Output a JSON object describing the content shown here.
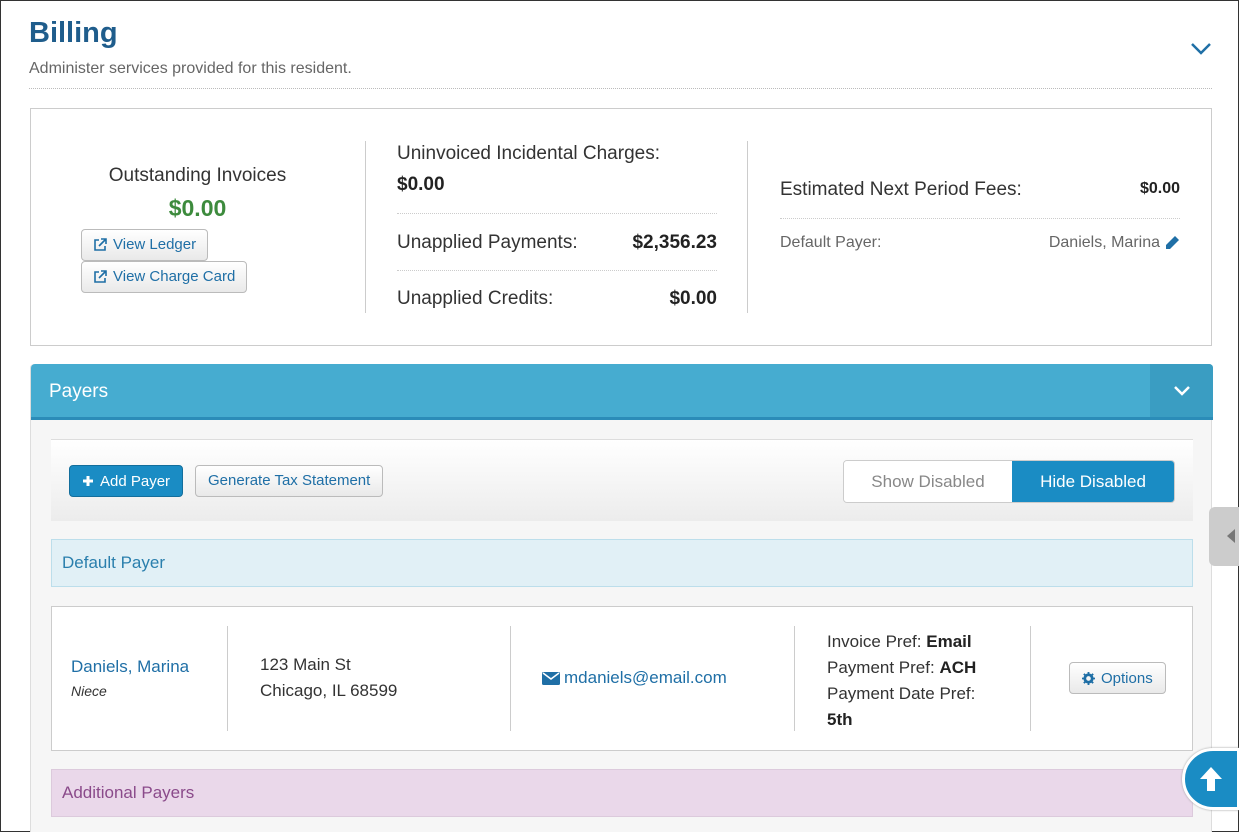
{
  "header": {
    "title": "Billing",
    "subtitle": "Administer services provided for this resident."
  },
  "summary": {
    "outstanding_label": "Outstanding Invoices",
    "outstanding_value": "$0.00",
    "view_ledger_label": "View Ledger",
    "view_charge_card_label": "View Charge Card",
    "uninvoiced_label": "Uninvoiced Incidental Charges:",
    "uninvoiced_value": "$0.00",
    "unapplied_payments_label": "Unapplied Payments:",
    "unapplied_payments_value": "$2,356.23",
    "unapplied_credits_label": "Unapplied Credits:",
    "unapplied_credits_value": "$0.00",
    "estimated_fees_label": "Estimated Next Period Fees:",
    "estimated_fees_value": "$0.00",
    "default_payer_label": "Default Payer:",
    "default_payer_value": "Daniels, Marina"
  },
  "payers": {
    "title": "Payers",
    "add_payer_label": "Add Payer",
    "generate_tax_label": "Generate Tax Statement",
    "show_disabled_label": "Show Disabled",
    "hide_disabled_label": "Hide Disabled",
    "default_section_label": "Default Payer",
    "additional_section_label": "Additional Payers",
    "default_payer": {
      "name": "Daniels, Marina",
      "relation": "Niece",
      "address_line1": "123 Main St",
      "address_line2": "Chicago, IL 68599",
      "email": "mdaniels@email.com",
      "invoice_pref_label": "Invoice Pref:",
      "invoice_pref_value": "Email",
      "payment_pref_label": "Payment Pref:",
      "payment_pref_value": "ACH",
      "payment_date_pref_label": "Payment Date Pref:",
      "payment_date_pref_value": "5th",
      "options_label": "Options"
    }
  },
  "colors": {
    "title": "#1f5d8c",
    "panel_header": "#46acd0",
    "primary": "#1a8cc4",
    "success": "#3d8b3d",
    "default_section_bg": "#e1f0f6",
    "additional_section_bg": "#ead8ea"
  }
}
